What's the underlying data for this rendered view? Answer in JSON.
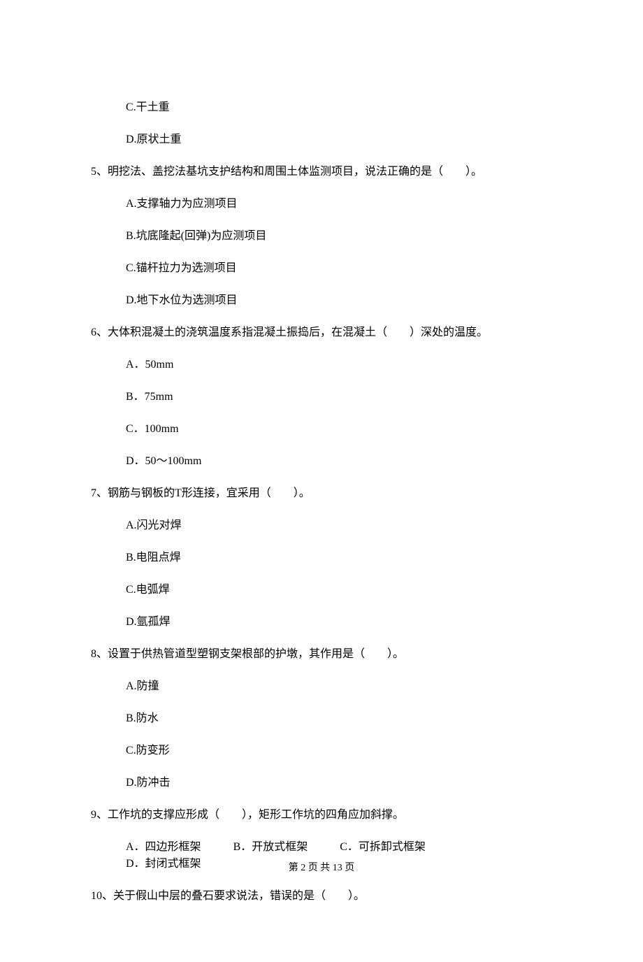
{
  "q4": {
    "optC": "C.干土重",
    "optD": "D.原状土重"
  },
  "q5": {
    "stem": "5、明挖法、盖挖法基坑支护结构和周围土体监测项目，说法正确的是（　　）。",
    "optA": "A.支撑轴力为应测项目",
    "optB": "B.坑底隆起(回弹)为应测项目",
    "optC": "C.锚杆拉力为选测项目",
    "optD": "D.地下水位为选测项目"
  },
  "q6": {
    "stem": "6、大体积混凝土的浇筑温度系指混凝土振捣后，在混凝土（　　）深处的温度。",
    "optA": "A．50mm",
    "optB": "B．75mm",
    "optC": "C．100mm",
    "optD": "D．50～100mm"
  },
  "q7": {
    "stem": "7、钢筋与钢板的T形连接，宜采用（　　）。",
    "optA": "A.闪光对焊",
    "optB": "B.电阻点焊",
    "optC": "C.电弧焊",
    "optD": "D.氩孤焊"
  },
  "q8": {
    "stem": "8、设置于供热管道型塑钢支架根部的护墩，其作用是（　　）。",
    "optA": "A.防撞",
    "optB": "B.防水",
    "optC": "C.防变形",
    "optD": "D.防冲击"
  },
  "q9": {
    "stem": "9、工作坑的支撑应形成（　　），矩形工作坑的四角应加斜撑。",
    "optA": "A．四边形框架",
    "optB": "B．开放式框架",
    "optC": "C．可拆卸式框架",
    "optD": "D．封闭式框架"
  },
  "q10": {
    "stem": "10、关于假山中层的叠石要求说法，错误的是（　　）。"
  },
  "footer": "第 2 页 共 13 页"
}
